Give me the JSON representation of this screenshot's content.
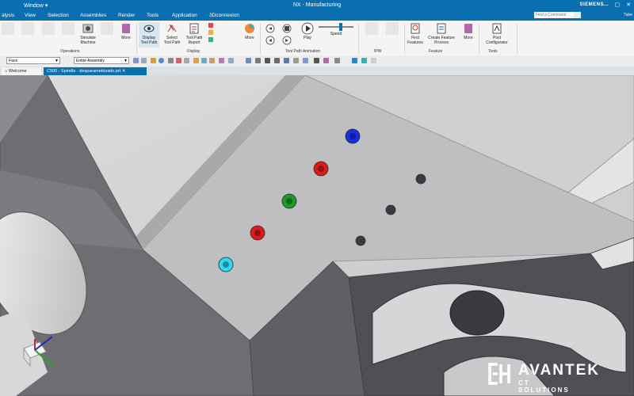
{
  "titlebar": {
    "window_menu": "Window ▾",
    "title": "NX - Manufacturing",
    "brand": "SIEMENS",
    "controls": [
      "—",
      "▢",
      "✕"
    ]
  },
  "menu": {
    "items": [
      "alysis",
      "View",
      "Selection",
      "Assemblies",
      "Render",
      "Tools",
      "Application",
      "3Dconnexion"
    ],
    "find_placeholder": "Find a Command",
    "user": "Tube"
  },
  "ribbon": {
    "buttons": [
      {
        "label": "Simulate\nMachine",
        "icon": "simulate-machine-icon",
        "dim": false
      },
      {
        "label": "More",
        "icon": "more-icon",
        "dim": false
      },
      {
        "label": "Display\nTool Path",
        "icon": "display-tool-path-icon",
        "dim": false
      },
      {
        "label": "Select\nTool Path",
        "icon": "select-tool-path-icon",
        "dim": false
      },
      {
        "label": "Tool Path\nReport",
        "icon": "tool-path-report-icon",
        "dim": false
      },
      {
        "label": "More",
        "icon": "more-icon",
        "dim": false
      },
      {
        "label": "Play",
        "icon": "play-icon",
        "dim": false
      },
      {
        "label": "Speed",
        "icon": "speed-slider-icon",
        "dim": false
      },
      {
        "label": "Find\nFeatures",
        "icon": "find-features-icon",
        "dim": false
      },
      {
        "label": "Create Feature\nProcess",
        "icon": "create-feature-process-icon",
        "dim": false
      },
      {
        "label": "More",
        "icon": "more-icon",
        "dim": false
      },
      {
        "label": "Post\nConfigurator",
        "icon": "post-configurator-icon",
        "dim": false
      }
    ],
    "groups": [
      "Operations",
      "Display",
      "Tool Path Animation",
      "IPW",
      "Feature",
      "Tools"
    ]
  },
  "quickbar": {
    "filter_value": "Face",
    "scope_value": "Entire Assembly"
  },
  "tabs": {
    "welcome": "Welcome Page",
    "part": "C500 - Spindle - desparametrizado.prt"
  },
  "viewport": {
    "feature_markers": [
      {
        "color": "#1a2fe0",
        "state": "highlighted"
      },
      {
        "color": "#e01a1a",
        "state": "highlighted"
      },
      {
        "color": "#1a9a2a",
        "state": "highlighted"
      },
      {
        "color": "#e01a1a",
        "state": "highlighted"
      },
      {
        "color": "#2ed8ee",
        "state": "highlighted"
      },
      {
        "color": "#3a3a40",
        "state": "plain"
      },
      {
        "color": "#3a3a40",
        "state": "plain"
      },
      {
        "color": "#3a3a40",
        "state": "plain"
      }
    ]
  },
  "watermark": {
    "name": "AVANTEK",
    "subtitle": "CT SOLUTIONS"
  },
  "colors": {
    "accent": "#0a6fb0",
    "model_face": "#bdbdbd",
    "model_dark": "#6a6a6e"
  }
}
